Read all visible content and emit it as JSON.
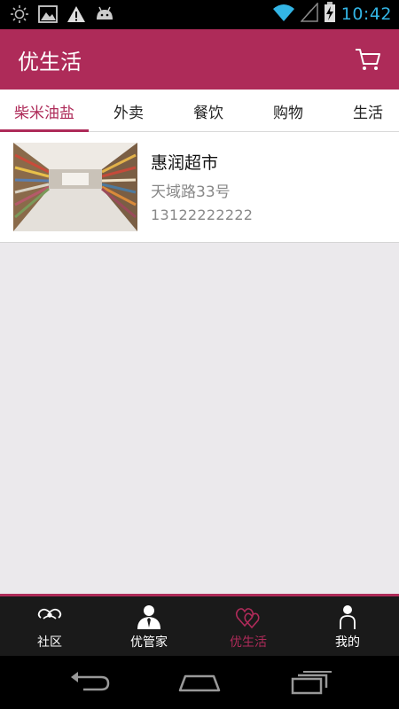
{
  "status_bar": {
    "time": "10:42",
    "left_icons": [
      "brightness-icon",
      "image-icon",
      "warning-icon",
      "android-icon"
    ],
    "right_icons": [
      "wifi-icon",
      "signal-icon",
      "battery-charging-icon"
    ]
  },
  "app_bar": {
    "title": "优生活",
    "action_icon": "cart-icon"
  },
  "tabs": [
    {
      "label": "柴米油盐",
      "active": true
    },
    {
      "label": "外卖",
      "active": false
    },
    {
      "label": "餐饮",
      "active": false
    },
    {
      "label": "购物",
      "active": false
    },
    {
      "label": "生活",
      "active": false
    }
  ],
  "stores": [
    {
      "name": "惠润超市",
      "address": "天域路33号",
      "phone": "13122222222",
      "thumbnail": "supermarket-aisle-image"
    }
  ],
  "bottom_nav": [
    {
      "label": "社区",
      "icon": "community-icon",
      "active": false
    },
    {
      "label": "优管家",
      "icon": "butler-icon",
      "active": false
    },
    {
      "label": "优生活",
      "icon": "hearts-icon",
      "active": true
    },
    {
      "label": "我的",
      "icon": "person-icon",
      "active": false
    }
  ],
  "system_nav": [
    "back-icon",
    "home-icon",
    "recents-icon"
  ],
  "colors": {
    "accent": "#ae2b59",
    "content_bg": "#ebe9ec",
    "nav_bg": "#1a1a1a",
    "clock": "#33b5e5"
  }
}
